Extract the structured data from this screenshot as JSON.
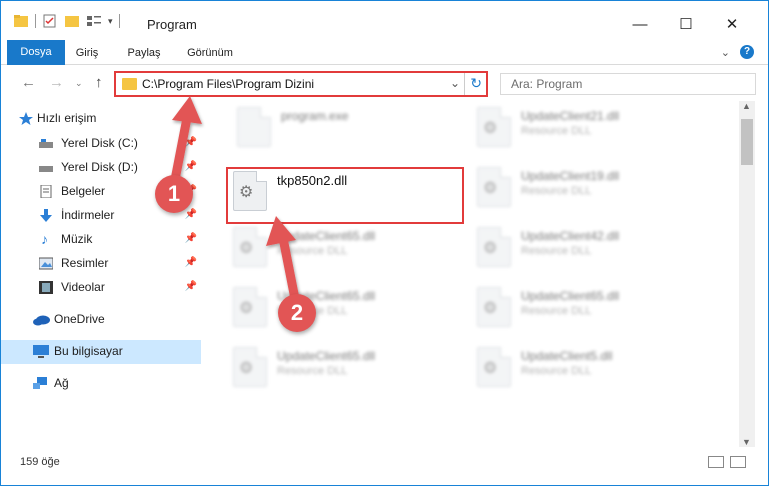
{
  "window": {
    "title": "Program"
  },
  "ribbon": {
    "tabs": [
      "Dosya",
      "Giriş",
      "Paylaş",
      "Görünüm"
    ],
    "help": "?"
  },
  "address": {
    "path": "C:\\Program Files\\Program Dizini"
  },
  "search": {
    "placeholder": "Ara: Program"
  },
  "sidebar": {
    "items": [
      {
        "label": "Hızlı erişim",
        "icon": "star-icon"
      },
      {
        "label": "Yerel Disk (C:)",
        "icon": "drive-icon"
      },
      {
        "label": "Yerel Disk (D:)",
        "icon": "drive-icon"
      },
      {
        "label": "Belgeler",
        "icon": "documents-icon"
      },
      {
        "label": "İndirmeler",
        "icon": "download-icon"
      },
      {
        "label": "Müzik",
        "icon": "music-icon"
      },
      {
        "label": "Resimler",
        "icon": "pictures-icon"
      },
      {
        "label": "Videolar",
        "icon": "video-icon"
      },
      {
        "label": "OneDrive",
        "icon": "cloud-icon"
      },
      {
        "label": "Bu bilgisayar",
        "icon": "computer-icon"
      },
      {
        "label": "Ağ",
        "icon": "network-icon"
      }
    ]
  },
  "files": [
    {
      "name": "program.exe",
      "type": ""
    },
    {
      "name": "UpdateClient21.dll",
      "type": "Resource DLL"
    },
    {
      "name": "tkp850n2.dll",
      "type": ""
    },
    {
      "name": "UpdateClient19.dll",
      "type": "Resource DLL"
    },
    {
      "name": "UpdateClient65.dll",
      "type": "Resource DLL"
    },
    {
      "name": "UpdateClient42.dll",
      "type": "Resource DLL"
    },
    {
      "name": "UpdateClient65.dll",
      "type": "Resource DLL"
    },
    {
      "name": "UpdateClient65.dll",
      "type": "Resource DLL"
    },
    {
      "name": "UpdateClient65.dll",
      "type": "Resource DLL"
    },
    {
      "name": "UpdateClient5.dll",
      "type": "Resource DLL"
    }
  ],
  "status": {
    "count": "159 öğe"
  },
  "badges": {
    "one": "1",
    "two": "2"
  },
  "colors": {
    "accent": "#1979ca",
    "highlight": "#e23b3b",
    "selected": "#cce8ff"
  }
}
